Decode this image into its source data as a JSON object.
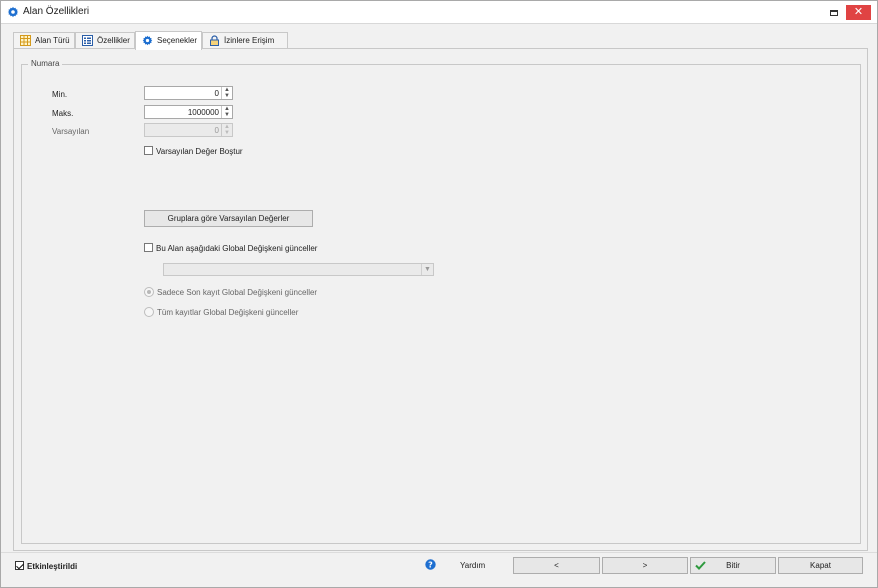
{
  "window": {
    "title": "Alan Özellikleri",
    "close_glyph": "✕"
  },
  "tabs": [
    {
      "label": "Alan Türü",
      "icon": "table-icon"
    },
    {
      "label": "Özellikler",
      "icon": "list-icon"
    },
    {
      "label": "Seçenekler",
      "icon": "gear-icon",
      "active": true
    },
    {
      "label": "İzinlere Erişim",
      "icon": "lock-icon"
    }
  ],
  "group": {
    "legend": "Numara"
  },
  "fields": {
    "min_label": "Min.",
    "min_value": "0",
    "max_label": "Maks.",
    "max_value": "1000000",
    "default_label": "Varsayılan",
    "default_value": "0"
  },
  "options": {
    "default_empty_label": "Varsayılan Değer Boştur",
    "group_defaults_button": "Gruplara göre Varsayılan Değerler",
    "update_global_label": "Bu Alan aşağıdaki Global Değişkeni günceller",
    "global_select_value": "",
    "radio_last_label": "Sadece Son kayıt Global Değişkeni günceller",
    "radio_all_label": "Tüm kayıtlar Global Değişkeni günceller"
  },
  "footer": {
    "enabled_label": "Etkinleştirildi",
    "help_label": "Yardım",
    "prev_label": "<",
    "next_label": ">",
    "finish_label": "Bitir",
    "close_label": "Kapat"
  },
  "colors": {
    "accent": "#1e6fd0",
    "close_button": "#e04343",
    "finish_check": "#2e9a3e"
  }
}
